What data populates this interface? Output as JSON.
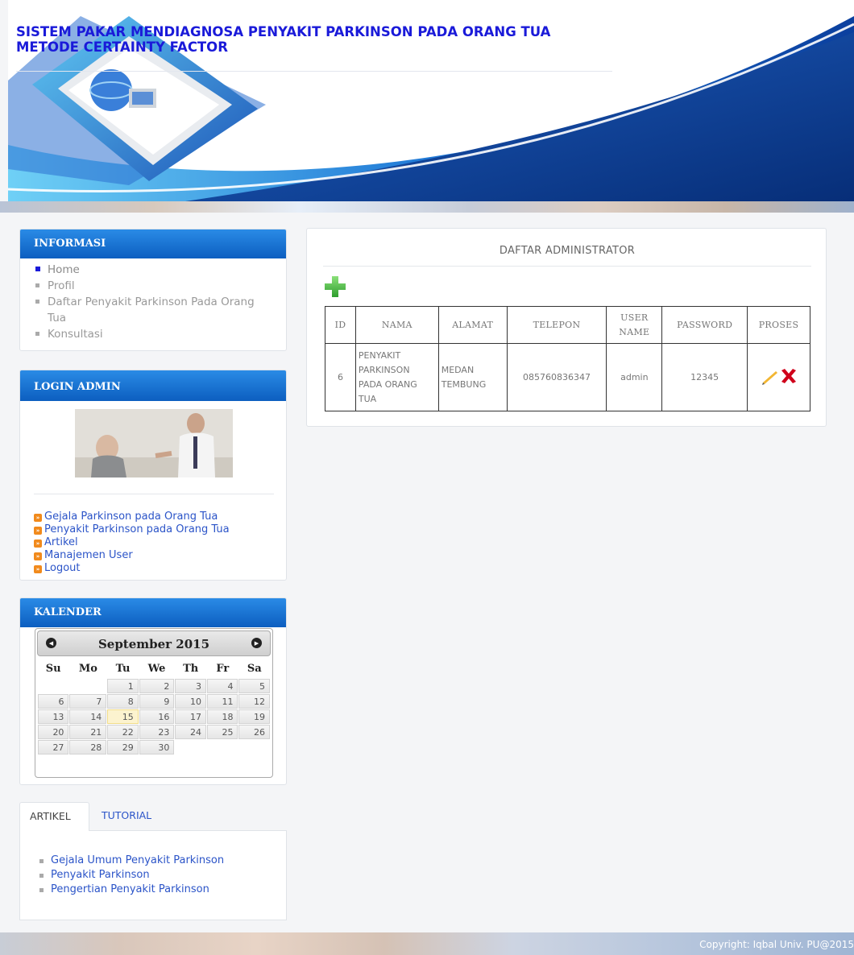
{
  "header": {
    "title_line1": "SISTEM PAKAR MENDIAGNOSA PENYAKIT PARKINSON PADA ORANG TUA",
    "title_line2": "METODE CERTAINTY FACTOR"
  },
  "informasi": {
    "heading": "INFORMASI",
    "items": [
      {
        "label": "Home",
        "active": true
      },
      {
        "label": "Profil"
      },
      {
        "label": "Daftar Penyakit Parkinson Pada Orang"
      },
      {
        "label": "Tua"
      },
      {
        "label": "Konsultasi"
      }
    ]
  },
  "login_admin": {
    "heading": "LOGIN ADMIN",
    "links": [
      "Gejala Parkinson pada Orang Tua",
      "Penyakit Parkinson pada Orang Tua",
      "Artikel",
      "Manajemen User",
      "Logout"
    ]
  },
  "kalender": {
    "heading": "KALENDER",
    "month_label": "September 2015",
    "weekdays": [
      "Su",
      "Mo",
      "Tu",
      "We",
      "Th",
      "Fr",
      "Sa"
    ],
    "weeks": [
      [
        "",
        "",
        "1",
        "2",
        "3",
        "4",
        "5"
      ],
      [
        "6",
        "7",
        "8",
        "9",
        "10",
        "11",
        "12"
      ],
      [
        "13",
        "14",
        "15",
        "16",
        "17",
        "18",
        "19"
      ],
      [
        "20",
        "21",
        "22",
        "23",
        "24",
        "25",
        "26"
      ],
      [
        "27",
        "28",
        "29",
        "30",
        "",
        "",
        ""
      ]
    ],
    "today": "15"
  },
  "tabs": {
    "artikel_label": "ARTIKEL",
    "tutorial_label": "TUTORIAL",
    "artikel_items": [
      "Gejala Umum Penyakit Parkinson",
      "Penyakit Parkinson",
      "Pengertian Penyakit Parkinson"
    ]
  },
  "main": {
    "title": "DAFTAR ADMINISTRATOR",
    "table": {
      "headers": [
        "ID",
        "NAMA",
        "ALAMAT",
        "TELEPON",
        "USER NAME",
        "PASSWORD",
        "PROSES"
      ],
      "rows": [
        {
          "id": "6",
          "nama": [
            "PENYAKIT",
            "PARKINSON",
            "PADA ORANG",
            "TUA"
          ],
          "alamat": [
            "MEDAN",
            "TEMBUNG"
          ],
          "telepon": "085760836347",
          "username": "admin",
          "password": "12345"
        }
      ]
    }
  },
  "footer": {
    "copyright": "Copyright: Iqbal Univ. PU@2015"
  },
  "icons": {
    "add": "plus-icon",
    "edit": "pencil-icon",
    "delete": "x-icon",
    "link_bullet": "double-arrow-icon"
  },
  "colors": {
    "title": "#1a1ad9",
    "block_header": "#0c5ec0",
    "link": "#2b54c8",
    "add_green": "#3fb43f",
    "delete_red": "#d0021b"
  }
}
